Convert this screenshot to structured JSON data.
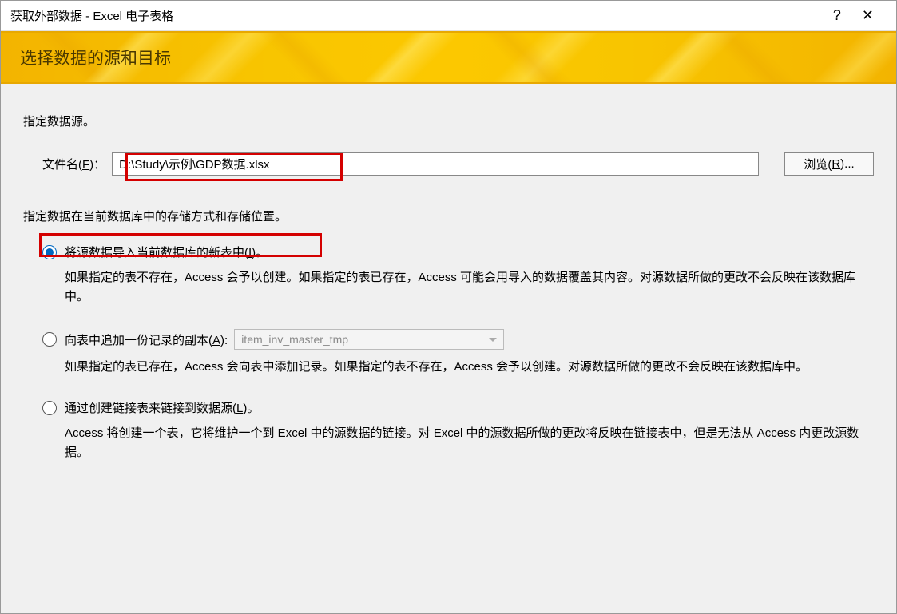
{
  "window": {
    "title": "获取外部数据 - Excel 电子表格"
  },
  "banner": {
    "title": "选择数据的源和目标"
  },
  "source": {
    "label": "指定数据源。",
    "file_label_pre": "文件名(",
    "file_label_key": "F",
    "file_label_post": ")：",
    "file_value": "D:\\Study\\示例\\GDP数据.xlsx",
    "browse_pre": "浏览(",
    "browse_key": "R",
    "browse_post": ")..."
  },
  "storage": {
    "label": "指定数据在当前数据库中的存储方式和存储位置。",
    "option1": {
      "label_pre": "将源数据导入当前数据库的新表中(",
      "label_key": "I",
      "label_post": ")。",
      "desc": "如果指定的表不存在，Access 会予以创建。如果指定的表已存在，Access 可能会用导入的数据覆盖其内容。对源数据所做的更改不会反映在该数据库中。",
      "selected": true
    },
    "option2": {
      "label_pre": "向表中追加一份记录的副本(",
      "label_key": "A",
      "label_post": "):",
      "dropdown_value": "item_inv_master_tmp",
      "desc": "如果指定的表已存在，Access 会向表中添加记录。如果指定的表不存在，Access 会予以创建。对源数据所做的更改不会反映在该数据库中。",
      "selected": false
    },
    "option3": {
      "label_pre": "通过创建链接表来链接到数据源(",
      "label_key": "L",
      "label_post": ")。",
      "desc": "Access 将创建一个表，它将维护一个到 Excel 中的源数据的链接。对 Excel 中的源数据所做的更改将反映在链接表中，但是无法从 Access 内更改源数据。",
      "selected": false
    }
  }
}
